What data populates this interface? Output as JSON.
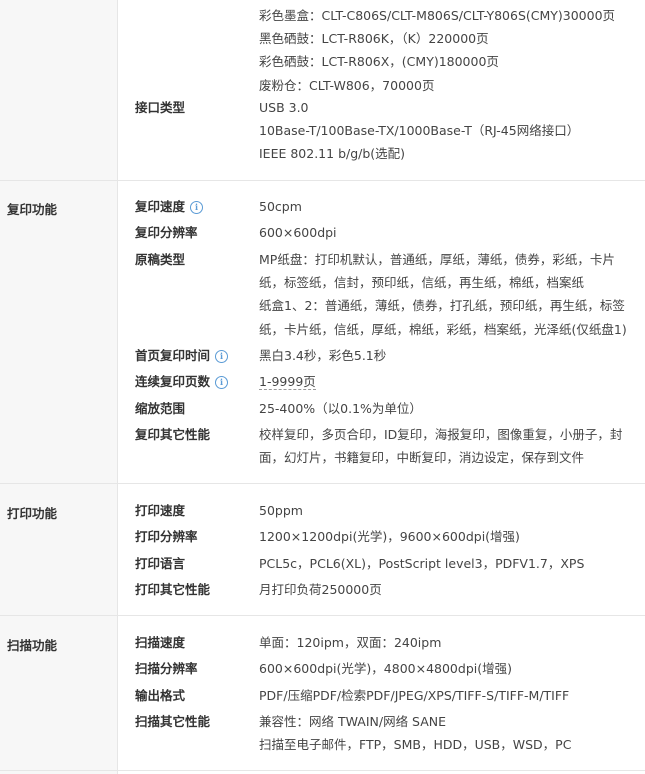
{
  "consumables": [
    "彩色墨盒：CLT-C806S/CLT-M806S/CLT-Y806S(CMY)30000页",
    "黑色硒鼓：LCT-R806K，（K）220000页",
    "彩色硒鼓：LCT-R806X，(CMY)180000页",
    "废粉仓：CLT-W806，70000页"
  ],
  "interface": {
    "label": "接口类型",
    "lines": [
      "USB 3.0",
      "10Base-T/100Base-TX/1000Base-T（RJ-45网络接口）",
      "IEEE 802.11 b/g/b(选配)"
    ]
  },
  "copy": {
    "category": "复印功能",
    "speed": {
      "label": "复印速度",
      "value": "50cpm"
    },
    "resolution": {
      "label": "复印分辨率",
      "value": "600×600dpi"
    },
    "original_type": {
      "label": "原稿类型",
      "lines": [
        "MP纸盘：打印机默认，普通纸，厚纸，薄纸，债券，彩纸，卡片",
        "纸，标签纸，信封，预印纸，信纸，再生纸，棉纸，档案纸",
        "纸盒1、2：普通纸，薄纸，债券，打孔纸，预印纸，再生纸，标签",
        "纸，卡片纸，信纸，厚纸，棉纸，彩纸，档案纸，光泽纸(仅纸盘1)"
      ]
    },
    "first_copy": {
      "label": "首页复印时间",
      "value": "黑白3.4秒，彩色5.1秒"
    },
    "continuous": {
      "label": "连续复印页数",
      "value": "1-9999页"
    },
    "zoom": {
      "label": "缩放范围",
      "value": "25-400%（以0.1%为单位）"
    },
    "other": {
      "label": "复印其它性能",
      "lines": [
        "校样复印，多页合印，ID复印，海报复印，图像重复，小册子，封",
        "面，幻灯片，书籍复印，中断复印，消边设定，保存到文件"
      ]
    }
  },
  "print": {
    "category": "打印功能",
    "speed": {
      "label": "打印速度",
      "value": "50ppm"
    },
    "resolution": {
      "label": "打印分辨率",
      "value": "1200×1200dpi(光学)，9600×600dpi(增强)"
    },
    "language": {
      "label": "打印语言",
      "value": "PCL5c，PCL6(XL)，PostScript level3，PDFV1.7，XPS"
    },
    "other": {
      "label": "打印其它性能",
      "value": "月打印负荷250000页"
    }
  },
  "scan": {
    "category": "扫描功能",
    "speed": {
      "label": "扫描速度",
      "value": "单面：120ipm，双面：240ipm"
    },
    "resolution": {
      "label": "扫描分辨率",
      "value": "600×600dpi(光学)，4800×4800dpi(增强)"
    },
    "format": {
      "label": "输出格式",
      "value": "PDF/压缩PDF/检索PDF/JPEG/XPS/TIFF-S/TIFF-M/TIFF"
    },
    "other": {
      "label": "扫描其它性能",
      "lines": [
        "兼容性：网络 TWAIN/网络 SANE",
        "扫描至电子邮件，FTP，SMB，HDD，USB，WSD，PC"
      ]
    }
  },
  "icons": {
    "info": "info-circle-icon"
  },
  "colors": {
    "info": "#5b9bd5",
    "border": "#e6e6e6",
    "category_bg": "#f7f7f7"
  }
}
